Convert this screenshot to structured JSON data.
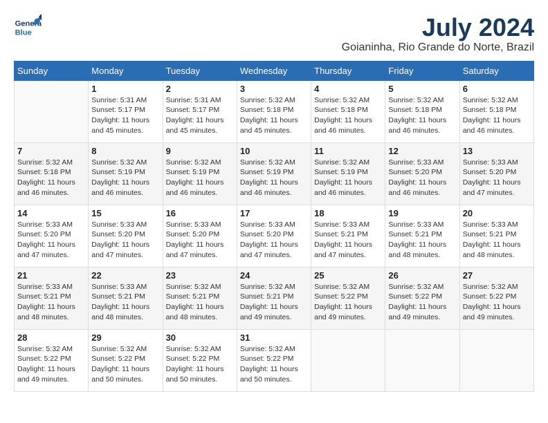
{
  "header": {
    "logo_general": "General",
    "logo_blue": "Blue",
    "month_year": "July 2024",
    "location": "Goianinha, Rio Grande do Norte, Brazil"
  },
  "weekdays": [
    "Sunday",
    "Monday",
    "Tuesday",
    "Wednesday",
    "Thursday",
    "Friday",
    "Saturday"
  ],
  "weeks": [
    [
      {
        "day": "",
        "info": ""
      },
      {
        "day": "1",
        "info": "Sunrise: 5:31 AM\nSunset: 5:17 PM\nDaylight: 11 hours\nand 45 minutes."
      },
      {
        "day": "2",
        "info": "Sunrise: 5:31 AM\nSunset: 5:17 PM\nDaylight: 11 hours\nand 45 minutes."
      },
      {
        "day": "3",
        "info": "Sunrise: 5:32 AM\nSunset: 5:18 PM\nDaylight: 11 hours\nand 45 minutes."
      },
      {
        "day": "4",
        "info": "Sunrise: 5:32 AM\nSunset: 5:18 PM\nDaylight: 11 hours\nand 46 minutes."
      },
      {
        "day": "5",
        "info": "Sunrise: 5:32 AM\nSunset: 5:18 PM\nDaylight: 11 hours\nand 46 minutes."
      },
      {
        "day": "6",
        "info": "Sunrise: 5:32 AM\nSunset: 5:18 PM\nDaylight: 11 hours\nand 46 minutes."
      }
    ],
    [
      {
        "day": "7",
        "info": "Sunrise: 5:32 AM\nSunset: 5:18 PM\nDaylight: 11 hours\nand 46 minutes."
      },
      {
        "day": "8",
        "info": "Sunrise: 5:32 AM\nSunset: 5:19 PM\nDaylight: 11 hours\nand 46 minutes."
      },
      {
        "day": "9",
        "info": "Sunrise: 5:32 AM\nSunset: 5:19 PM\nDaylight: 11 hours\nand 46 minutes."
      },
      {
        "day": "10",
        "info": "Sunrise: 5:32 AM\nSunset: 5:19 PM\nDaylight: 11 hours\nand 46 minutes."
      },
      {
        "day": "11",
        "info": "Sunrise: 5:32 AM\nSunset: 5:19 PM\nDaylight: 11 hours\nand 46 minutes."
      },
      {
        "day": "12",
        "info": "Sunrise: 5:33 AM\nSunset: 5:20 PM\nDaylight: 11 hours\nand 46 minutes."
      },
      {
        "day": "13",
        "info": "Sunrise: 5:33 AM\nSunset: 5:20 PM\nDaylight: 11 hours\nand 47 minutes."
      }
    ],
    [
      {
        "day": "14",
        "info": "Sunrise: 5:33 AM\nSunset: 5:20 PM\nDaylight: 11 hours\nand 47 minutes."
      },
      {
        "day": "15",
        "info": "Sunrise: 5:33 AM\nSunset: 5:20 PM\nDaylight: 11 hours\nand 47 minutes."
      },
      {
        "day": "16",
        "info": "Sunrise: 5:33 AM\nSunset: 5:20 PM\nDaylight: 11 hours\nand 47 minutes."
      },
      {
        "day": "17",
        "info": "Sunrise: 5:33 AM\nSunset: 5:20 PM\nDaylight: 11 hours\nand 47 minutes."
      },
      {
        "day": "18",
        "info": "Sunrise: 5:33 AM\nSunset: 5:21 PM\nDaylight: 11 hours\nand 47 minutes."
      },
      {
        "day": "19",
        "info": "Sunrise: 5:33 AM\nSunset: 5:21 PM\nDaylight: 11 hours\nand 48 minutes."
      },
      {
        "day": "20",
        "info": "Sunrise: 5:33 AM\nSunset: 5:21 PM\nDaylight: 11 hours\nand 48 minutes."
      }
    ],
    [
      {
        "day": "21",
        "info": "Sunrise: 5:33 AM\nSunset: 5:21 PM\nDaylight: 11 hours\nand 48 minutes."
      },
      {
        "day": "22",
        "info": "Sunrise: 5:33 AM\nSunset: 5:21 PM\nDaylight: 11 hours\nand 48 minutes."
      },
      {
        "day": "23",
        "info": "Sunrise: 5:32 AM\nSunset: 5:21 PM\nDaylight: 11 hours\nand 48 minutes."
      },
      {
        "day": "24",
        "info": "Sunrise: 5:32 AM\nSunset: 5:21 PM\nDaylight: 11 hours\nand 49 minutes."
      },
      {
        "day": "25",
        "info": "Sunrise: 5:32 AM\nSunset: 5:22 PM\nDaylight: 11 hours\nand 49 minutes."
      },
      {
        "day": "26",
        "info": "Sunrise: 5:32 AM\nSunset: 5:22 PM\nDaylight: 11 hours\nand 49 minutes."
      },
      {
        "day": "27",
        "info": "Sunrise: 5:32 AM\nSunset: 5:22 PM\nDaylight: 11 hours\nand 49 minutes."
      }
    ],
    [
      {
        "day": "28",
        "info": "Sunrise: 5:32 AM\nSunset: 5:22 PM\nDaylight: 11 hours\nand 49 minutes."
      },
      {
        "day": "29",
        "info": "Sunrise: 5:32 AM\nSunset: 5:22 PM\nDaylight: 11 hours\nand 50 minutes."
      },
      {
        "day": "30",
        "info": "Sunrise: 5:32 AM\nSunset: 5:22 PM\nDaylight: 11 hours\nand 50 minutes."
      },
      {
        "day": "31",
        "info": "Sunrise: 5:32 AM\nSunset: 5:22 PM\nDaylight: 11 hours\nand 50 minutes."
      },
      {
        "day": "",
        "info": ""
      },
      {
        "day": "",
        "info": ""
      },
      {
        "day": "",
        "info": ""
      }
    ]
  ]
}
